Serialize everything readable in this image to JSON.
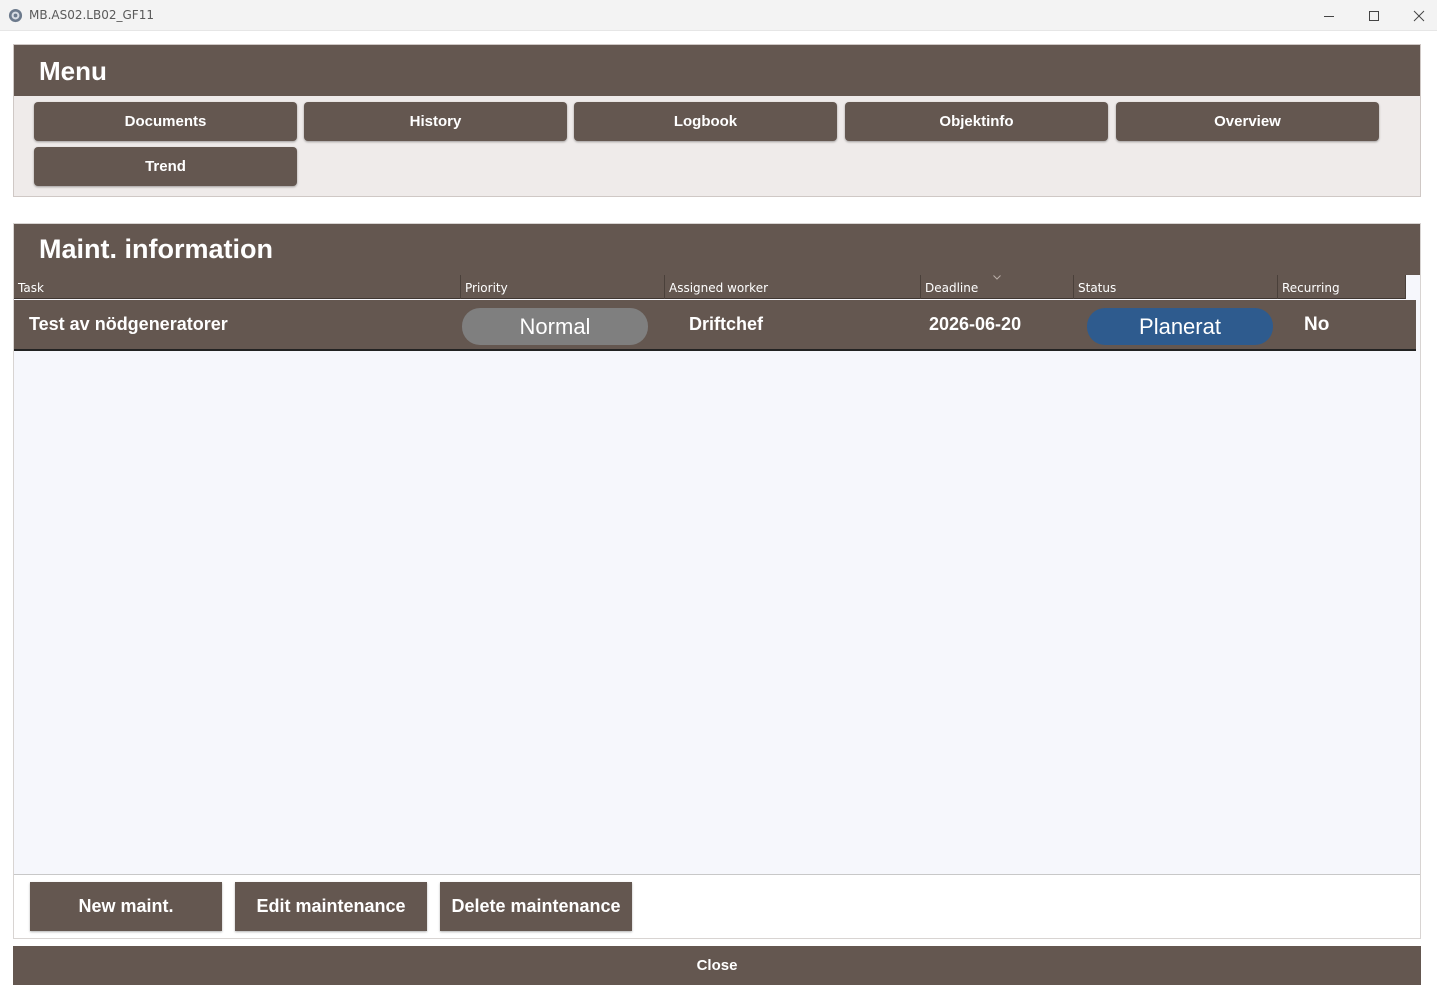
{
  "window": {
    "title": "MB.AS02.LB02_GF11",
    "controls": [
      "minimize-icon",
      "maximize-icon",
      "close-icon"
    ]
  },
  "menu": {
    "title": "Menu",
    "buttons": [
      "Documents",
      "History",
      "Logbook",
      "Objektinfo",
      "Overview",
      "Trend"
    ]
  },
  "maint": {
    "title": "Maint. information",
    "columns": [
      "Task",
      "Priority",
      "Assigned worker",
      "Deadline",
      "Status",
      "Recurring"
    ],
    "rows": [
      {
        "task": "Test av nödgeneratorer",
        "priority": "Normal",
        "assigned_worker": "Driftchef",
        "deadline": "2026-06-20",
        "status": "Planerat",
        "recurring": "No"
      }
    ]
  },
  "actions": {
    "new": "New maint.",
    "edit": "Edit maintenance",
    "delete": "Delete maintenance"
  },
  "footer": {
    "close": "Close"
  },
  "colors": {
    "panel_brown": "#645750",
    "priority_pill": "#7f7f7f",
    "status_pill": "#2e5b8e",
    "grid_background": "#f6f7fc"
  }
}
